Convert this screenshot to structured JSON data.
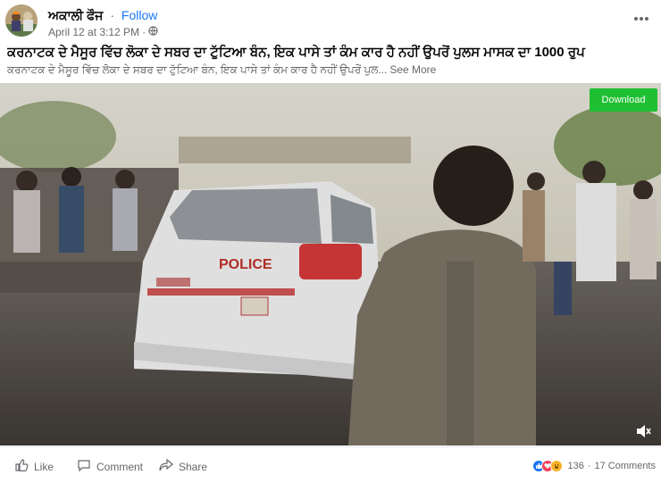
{
  "post": {
    "author": "ਅਕਾਲੀ ਫੌਜ",
    "separator": "·",
    "follow_label": "Follow",
    "timestamp": "April 12 at 3:12 PM",
    "meta_separator": "·",
    "privacy_icon": "globe-icon",
    "more_icon": "more-horizontal-icon",
    "title": "ਕਰਨਾਟਕ ਦੇ ਮੈਸੂਰ ਵਿੱਚ ਲੋਕਾ ਦੇ ਸਬਰ ਦਾ ਟੁੱਟਿਆ ਬੰਨ, ਇਕ ਪਾਸੇ ਤਾਂ ਕੰਮ ਕਾਰ ਹੈ ਨਹੀਂ ਉਪਰੋਂ ਪੁਲਸ ਮਾਸਕ ਦਾ 1000 ਰੁਪ",
    "body": "ਕਰਨਾਟਕ ਦੇ ਮੈਸੂਰ ਵਿੱਚ ਲੋਕਾ ਦੇ ਸਬਰ ਦਾ ਟੁੱਟਿਆ ਬੰਨ, ਇਕ ਪਾਸੇ ਤਾਂ ਕੰਮ ਕਾਰ ਹੈ ਨਹੀਂ ਉਪਰੋਂ ਪੁਲ...",
    "see_more": "See More"
  },
  "video": {
    "download_label": "Download",
    "police_text": "POLICE",
    "volume_icon": "volume-icon"
  },
  "actions": {
    "like_label": "Like",
    "comment_label": "Comment",
    "share_label": "Share"
  },
  "reactions": {
    "icons": [
      "like-reaction-icon",
      "love-reaction-icon",
      "haha-reaction-icon"
    ],
    "count": "136",
    "separator": "·",
    "comments": "17 Comments"
  },
  "colors": {
    "accent": "#1877f2",
    "download": "#1fbf33",
    "secondary_text": "#65676b",
    "like_reaction": "#1877f2",
    "love_reaction": "#f33e58",
    "haha_reaction": "#f7b125"
  }
}
